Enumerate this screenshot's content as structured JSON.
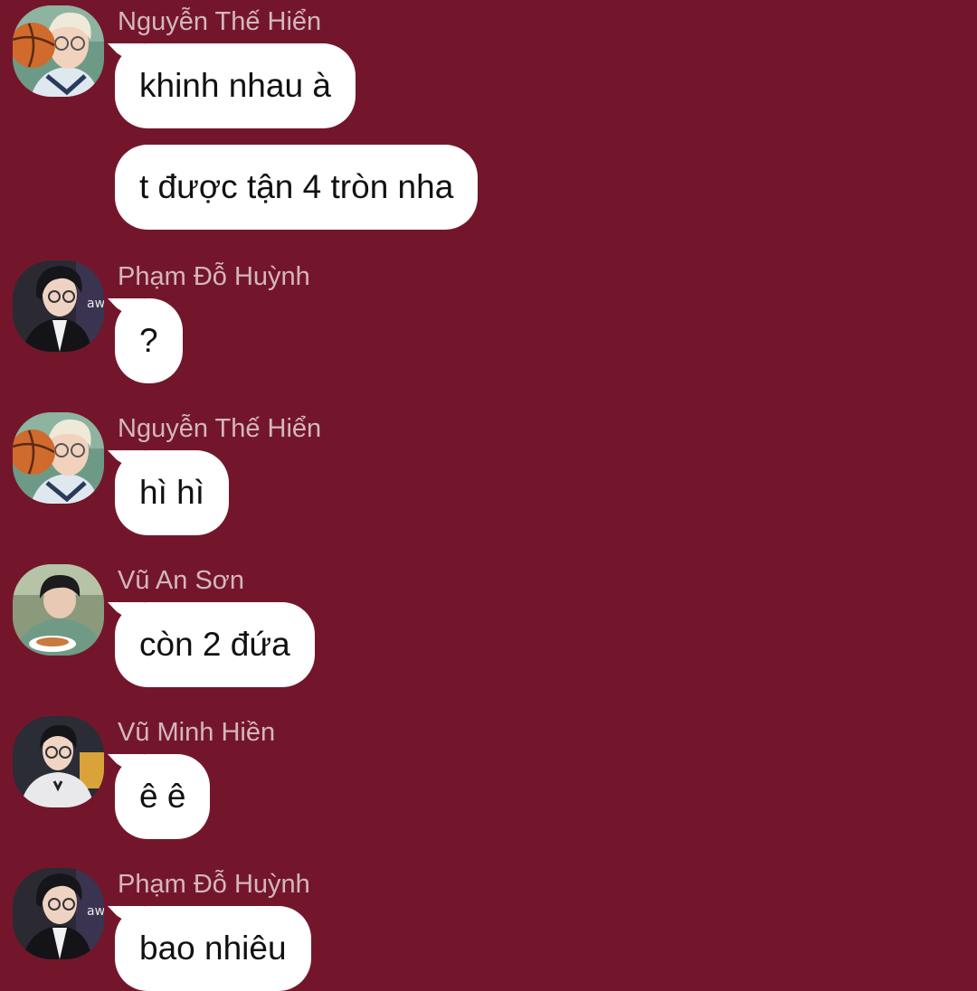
{
  "messages": [
    {
      "sender": "Nguyễn Thế Hiển",
      "avatar": "basketball-boy-avatar",
      "bubbles": [
        "khinh nhau à",
        "t được tận 4 tròn nha"
      ]
    },
    {
      "sender": "Phạm Đỗ Huỳnh",
      "avatar": "black-jacket-avatar",
      "bubbles": [
        "?"
      ]
    },
    {
      "sender": "Nguyễn Thế Hiển",
      "avatar": "basketball-boy-avatar",
      "bubbles": [
        "hì hì"
      ]
    },
    {
      "sender": "Vũ An Sơn",
      "avatar": "eating-noodles-avatar",
      "bubbles": [
        "còn 2 đứa"
      ]
    },
    {
      "sender": "Vũ Minh Hiền",
      "avatar": "glasses-jersey-avatar",
      "bubbles": [
        "ê ê"
      ]
    },
    {
      "sender": "Phạm Đỗ Huỳnh",
      "avatar": "black-jacket-avatar",
      "bubbles": [
        "bao nhiêu"
      ]
    }
  ],
  "colors": {
    "background": "#74162b",
    "bubble": "#ffffff",
    "sender_name": "#d3b7bd",
    "message_text": "#111111"
  }
}
